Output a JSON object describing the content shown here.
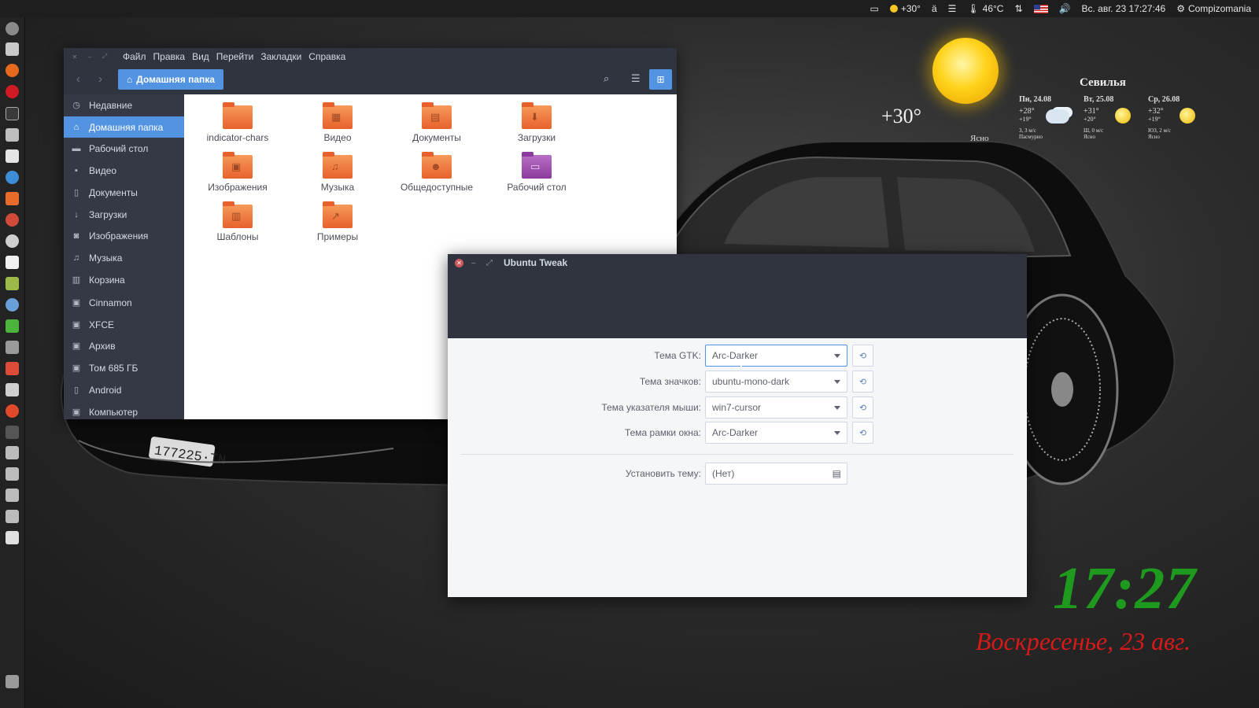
{
  "top_panel": {
    "weather_temp": "+30°",
    "cpu_temp": "46°C",
    "datetime": "Вс. авг. 23 17:27:46",
    "session_user": "Compizomania"
  },
  "desktop_weather": {
    "current_temp": "+30°",
    "condition": "Ясно",
    "city": "Севилья",
    "forecast": [
      {
        "day": "Пн, 24.08",
        "high": "+28°",
        "low": "+19°",
        "wind": "З, 3 м/с",
        "summary": "Пасмурно",
        "icon": "cloud-icon"
      },
      {
        "day": "Вт, 25.08",
        "high": "+31°",
        "low": "+20°",
        "wind": "Ш, 0 м/с",
        "summary": "Ясно",
        "icon": "sun-icon"
      },
      {
        "day": "Ср, 26.08",
        "high": "+32°",
        "low": "+19°",
        "wind": "ЮЗ, 2 м/с",
        "summary": "Ясно",
        "icon": "sun-icon"
      }
    ]
  },
  "clock": {
    "time": "17:27",
    "date": "Воскресенье, 23 авг."
  },
  "file_manager": {
    "menu": [
      "Файл",
      "Правка",
      "Вид",
      "Перейти",
      "Закладки",
      "Справка"
    ],
    "path_label": "Домашняя папка",
    "sidebar": [
      {
        "label": "Недавние",
        "icon": "recent-icon"
      },
      {
        "label": "Домашняя папка",
        "icon": "home-icon",
        "active": true
      },
      {
        "label": "Рабочий стол",
        "icon": "desktop-icon"
      },
      {
        "label": "Видео",
        "icon": "video-icon"
      },
      {
        "label": "Документы",
        "icon": "document-icon"
      },
      {
        "label": "Загрузки",
        "icon": "download-icon"
      },
      {
        "label": "Изображения",
        "icon": "camera-icon"
      },
      {
        "label": "Музыка",
        "icon": "music-icon"
      },
      {
        "label": "Корзина",
        "icon": "trash-icon"
      },
      {
        "label": "Cinnamon",
        "icon": "bookmark-icon"
      },
      {
        "label": "XFCE",
        "icon": "bookmark-icon"
      },
      {
        "label": "Архив",
        "icon": "bookmark-icon"
      },
      {
        "label": "Том 685 ГБ",
        "icon": "drive-icon"
      },
      {
        "label": "Android",
        "icon": "phone-icon"
      },
      {
        "label": "Компьютер",
        "icon": "computer-icon"
      }
    ],
    "folders": [
      {
        "label": "indicator-chars",
        "emblem": ""
      },
      {
        "label": "Видео",
        "emblem": "▦"
      },
      {
        "label": "Документы",
        "emblem": "▤"
      },
      {
        "label": "Загрузки",
        "emblem": "⬇"
      },
      {
        "label": "Изображения",
        "emblem": "▣"
      },
      {
        "label": "Музыка",
        "emblem": "♫"
      },
      {
        "label": "Общедоступные",
        "emblem": "☻"
      },
      {
        "label": "Рабочий стол",
        "emblem": "▭"
      },
      {
        "label": "Шаблоны",
        "emblem": "▥"
      },
      {
        "label": "Примеры",
        "emblem": "↗"
      }
    ]
  },
  "ubuntu_tweak": {
    "title": "Ubuntu Tweak",
    "rows": [
      {
        "label": "Тема GTK:",
        "value": "Arc-Darker"
      },
      {
        "label": "Тема значков:",
        "value": "ubuntu-mono-dark"
      },
      {
        "label": "Тема указателя мыши:",
        "value": "win7-cursor"
      },
      {
        "label": "Тема рамки окна:",
        "value": "Arc-Darker"
      }
    ],
    "install": {
      "label": "Установить тему:",
      "value": "(Нет)"
    }
  },
  "colors": {
    "accent": "#5294e2",
    "header_dark": "#2f343f",
    "sidebar": "#353945",
    "clock_green": "#1e9a1e",
    "date_red": "#d61a1a",
    "folder_orange": "#e8612c"
  }
}
